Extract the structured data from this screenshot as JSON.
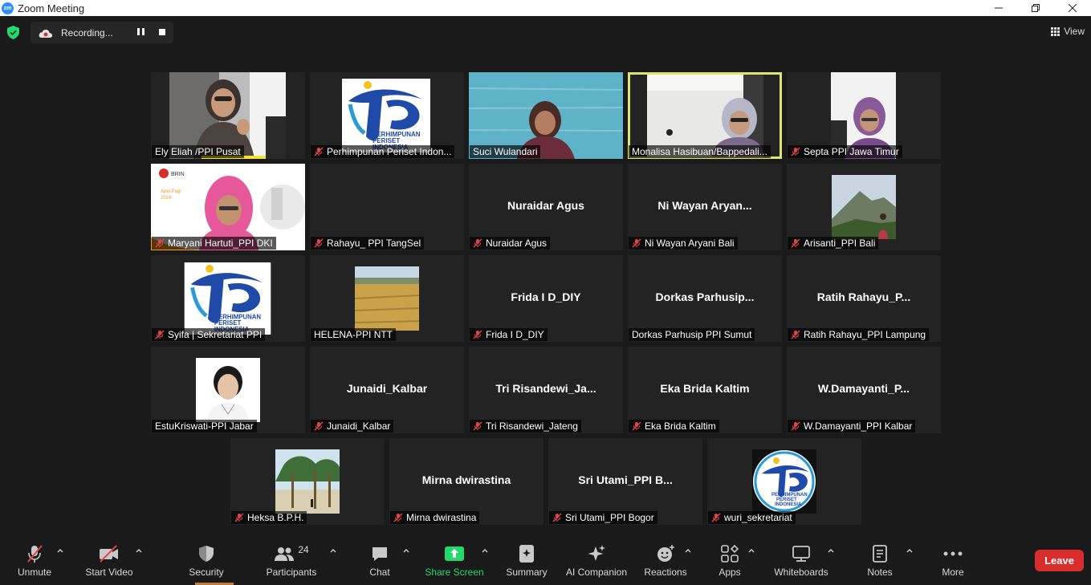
{
  "window": {
    "title": "Zoom Meeting",
    "logo_text": "zm"
  },
  "recording": {
    "label": "Recording..."
  },
  "view": {
    "label": "View"
  },
  "participants_count": "24",
  "tiles": [
    {
      "name": "Ely Eliah /PPI Pusat",
      "muted": false,
      "big": ""
    },
    {
      "name": "Perhimpunan Periset Indon...",
      "muted": true,
      "big": ""
    },
    {
      "name": "Suci Wulandari",
      "muted": false,
      "big": ""
    },
    {
      "name": "Monalisa Hasibuan/Bappedali...",
      "muted": false,
      "big": "",
      "active": true
    },
    {
      "name": "Septa PPI Jawa Timur",
      "muted": true,
      "big": ""
    },
    {
      "name": "Maryani Hartuti_PPI DKI",
      "muted": true,
      "big": ""
    },
    {
      "name": "Rahayu_ PPI TangSel",
      "muted": true,
      "big": ""
    },
    {
      "name": "Nuraidar Agus",
      "muted": true,
      "big": "Nuraidar Agus"
    },
    {
      "name": "Ni Wayan Aryani Bali",
      "muted": true,
      "big": "Ni Wayan Aryan..."
    },
    {
      "name": "Arisanti_PPI Bali",
      "muted": true,
      "big": ""
    },
    {
      "name": "Syifa | Sekretariat PPI",
      "muted": true,
      "big": ""
    },
    {
      "name": "HELENA-PPI NTT",
      "muted": false,
      "big": ""
    },
    {
      "name": "Frida I D_DIY",
      "muted": true,
      "big": "Frida I D_DIY"
    },
    {
      "name": "Dorkas Parhusip PPI Sumut",
      "muted": false,
      "big": "Dorkas  Parhusip..."
    },
    {
      "name": "Ratih Rahayu_PPI Lampung",
      "muted": true,
      "big": "Ratih  Rahayu_P..."
    },
    {
      "name": "EstuKriswati-PPI Jabar",
      "muted": false,
      "big": ""
    },
    {
      "name": "Junaidi_Kalbar",
      "muted": true,
      "big": "Junaidi_Kalbar"
    },
    {
      "name": "Tri Risandewi_Jateng",
      "muted": true,
      "big": "Tri  Risandewi_Ja..."
    },
    {
      "name": "Eka Brida Kaltim",
      "muted": true,
      "big": "Eka Brida Kaltim"
    },
    {
      "name": "W.Damayanti_PPI Kalbar",
      "muted": true,
      "big": "W.Damayanti_P..."
    },
    {
      "name": "Heksa B.P.H.",
      "muted": true,
      "big": ""
    },
    {
      "name": "Mirna dwirastina",
      "muted": true,
      "big": "Mirna dwirastina"
    },
    {
      "name": "Sri Utami_PPI Bogor",
      "muted": true,
      "big": "Sri  Utami_PPI  B..."
    },
    {
      "name": "wuri_sekretariat",
      "muted": true,
      "big": ""
    }
  ],
  "logo_text": {
    "line1": "PERHIMPUNAN",
    "line2": "PERISET",
    "line3": "INDONESIA"
  },
  "brin": {
    "brand": "BRIN",
    "line1": "Apel Pagi",
    "line2": "2024"
  },
  "toolbar": {
    "unmute": "Unmute",
    "start_video": "Start Video",
    "security": "Security",
    "participants": "Participants",
    "chat": "Chat",
    "share_screen": "Share Screen",
    "summary": "Summary",
    "ai_companion": "AI Companion",
    "reactions": "Reactions",
    "apps": "Apps",
    "whiteboards": "Whiteboards",
    "notes": "Notes",
    "more": "More",
    "leave": "Leave"
  },
  "colors": {
    "active_border": "#dbe66e",
    "leave": "#d92d2d",
    "share_green": "#23d96e",
    "zoom_blue": "#2d8cff"
  }
}
